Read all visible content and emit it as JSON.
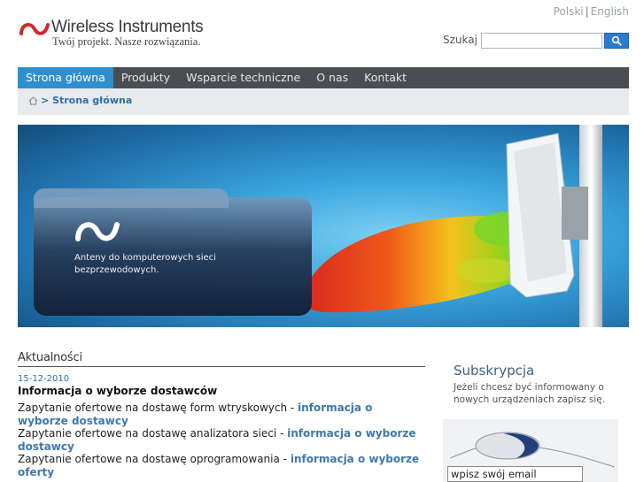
{
  "header": {
    "logo_name": "Wireless Instruments",
    "logo_tagline": "Twój projekt. Nasze rozwiązania.",
    "languages": [
      "Polski",
      "English"
    ],
    "language_separator": "|",
    "search": {
      "label": "Szukaj",
      "value": "",
      "button_icon": "search-icon"
    }
  },
  "nav": {
    "items": [
      {
        "label": "Strona główna",
        "active": true
      },
      {
        "label": "Produkty",
        "active": false
      },
      {
        "label": "Wsparcie techniczne",
        "active": false
      },
      {
        "label": "O nas",
        "active": false
      },
      {
        "label": "Kontakt",
        "active": false
      }
    ]
  },
  "breadcrumb": {
    "icon": "home-icon",
    "separator": ">",
    "current": "Strona główna"
  },
  "banner": {
    "text": "Anteny do komputerowych sieci bezprzewodowych."
  },
  "news": {
    "title": "Aktualności",
    "date": "15-12-2010",
    "headline": "Informacja o wyborze dostawców",
    "items": [
      {
        "text": "Zapytanie ofertowe na dostawę form wtryskowych - ",
        "link": "informacja o wyborze dostawcy"
      },
      {
        "text": "Zapytanie ofertowe na dostawę analizatora sieci - ",
        "link": "informacja o wyborze dostawcy"
      },
      {
        "text": "Zapytanie ofertowe na dostawę oprogramowania - ",
        "link": "informacja o wyborze oferty"
      }
    ]
  },
  "subscription": {
    "title": "Subskrypcja",
    "text": "Jeżeli chcesz być informowany o nowych urządzeniach zapisz się.",
    "email_value": "wpisz swój email"
  },
  "colors": {
    "nav_bg": "#4a4e52",
    "nav_active": "#2e8fcf",
    "link": "#3f78ad",
    "brand_red": "#d0282e"
  }
}
